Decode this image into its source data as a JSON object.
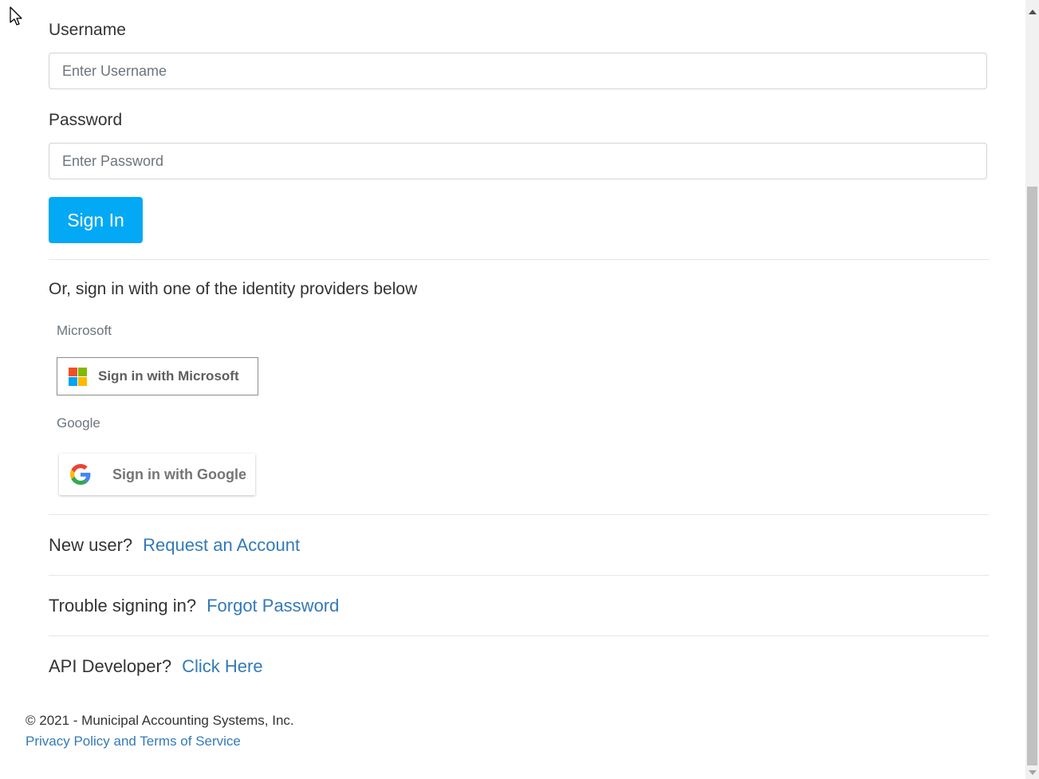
{
  "form": {
    "username_label": "Username",
    "username_placeholder": "Enter Username",
    "password_label": "Password",
    "password_placeholder": "Enter Password",
    "signin_button": "Sign In"
  },
  "providers": {
    "heading": "Or, sign in with one of the identity providers below",
    "microsoft_label": "Microsoft",
    "microsoft_button": "Sign in with Microsoft",
    "google_label": "Google",
    "google_button": "Sign in with Google"
  },
  "links": {
    "new_user_question": "New user?",
    "new_user_link": "Request an Account",
    "trouble_question": "Trouble signing in?",
    "trouble_link": "Forgot Password",
    "api_question": "API Developer?",
    "api_link": "Click Here"
  },
  "footer": {
    "copyright": "© 2021 - Municipal Accounting Systems, Inc.",
    "privacy_link": "Privacy Policy and Terms of Service"
  },
  "colors": {
    "primary_button": "#03a9f4",
    "link": "#337ab7",
    "ms_red": "#f25022",
    "ms_green": "#7fba00",
    "ms_blue": "#00a4ef",
    "ms_yellow": "#ffb900"
  },
  "icons": {
    "cursor": "mouse-pointer-icon",
    "microsoft": "microsoft-logo-icon",
    "google": "google-logo-icon"
  }
}
